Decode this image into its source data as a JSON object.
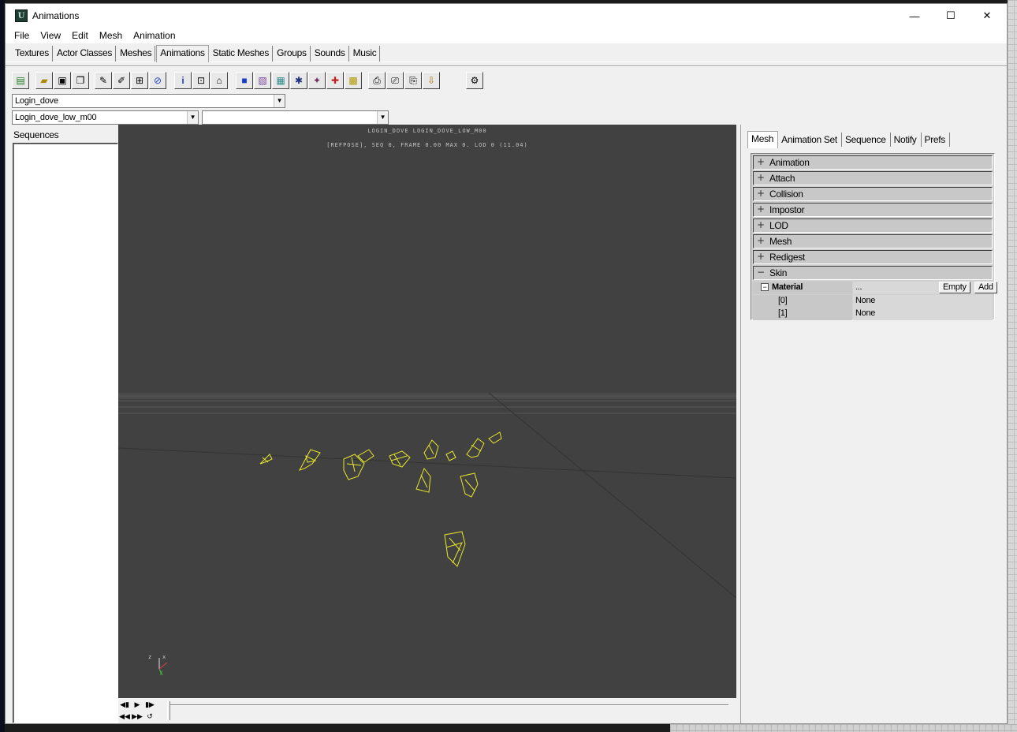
{
  "window": {
    "title": "Animations",
    "minimize_glyph": "—",
    "maximize_glyph": "☐",
    "close_glyph": "✕",
    "app_icon_letter": "U"
  },
  "menu": [
    "File",
    "View",
    "Edit",
    "Mesh",
    "Animation"
  ],
  "tabs": [
    "Textures",
    "Actor Classes",
    "Meshes",
    "Animations",
    "Static Meshes",
    "Groups",
    "Sounds",
    "Music"
  ],
  "active_tab": "Animations",
  "toolbar": {
    "icons": [
      "actor-class-icon",
      "open-icon",
      "save-icon",
      "copy-icon",
      "mesh-props-icon",
      "mesh-edit-icon",
      "mesh-add-icon",
      "link-icon",
      "info-icon",
      "mesh-info-icon",
      "mesh-home-icon",
      "cube-icon",
      "bone-icon",
      "wireframe-icon",
      "skeleton-icon",
      "normals-icon",
      "pivot-icon",
      "bounds-icon",
      "lod-icon",
      "sockets-icon",
      "attach-icon",
      "export-icon",
      "prefs-icon"
    ]
  },
  "package_combo": {
    "value": "Login_dove"
  },
  "mesh_combo": {
    "value": "Login_dove_low_m00"
  },
  "anim_combo": {
    "value": ""
  },
  "sequences": {
    "label": "Sequences",
    "items": []
  },
  "viewport": {
    "line1": "LOGIN_DOVE LOGIN_DOVE_LOW_M00",
    "line2": "[REFPOSE], SEQ 0, FRAME 0.00 MAX 0. LOD 0 (11.04)",
    "axis_labels": {
      "z": "z",
      "x": "x",
      "y": "y"
    }
  },
  "timeline": {
    "buttons": [
      "◀▮",
      "▶",
      "▮▶",
      "◀◀",
      "▶▶",
      "↺"
    ]
  },
  "right_tabs": [
    "Mesh",
    "Animation Set",
    "Sequence",
    "Notify",
    "Prefs"
  ],
  "active_right_tab": "Mesh",
  "properties": {
    "categories": [
      {
        "label": "Animation",
        "expanded": false
      },
      {
        "label": "Attach",
        "expanded": false
      },
      {
        "label": "Collision",
        "expanded": false
      },
      {
        "label": "Impostor",
        "expanded": false
      },
      {
        "label": "LOD",
        "expanded": false
      },
      {
        "label": "Mesh",
        "expanded": false
      },
      {
        "label": "Redigest",
        "expanded": false
      },
      {
        "label": "Skin",
        "expanded": true
      }
    ],
    "material": {
      "label": "Material",
      "value": "...",
      "empty_button": "Empty",
      "add_button": "Add",
      "entries": [
        {
          "index": "[0]",
          "value": "None"
        },
        {
          "index": "[1]",
          "value": "None"
        }
      ]
    }
  },
  "colors": {
    "viewport_bg": "#414141",
    "wireframe": "#e8e82a",
    "grid": "#555555"
  }
}
